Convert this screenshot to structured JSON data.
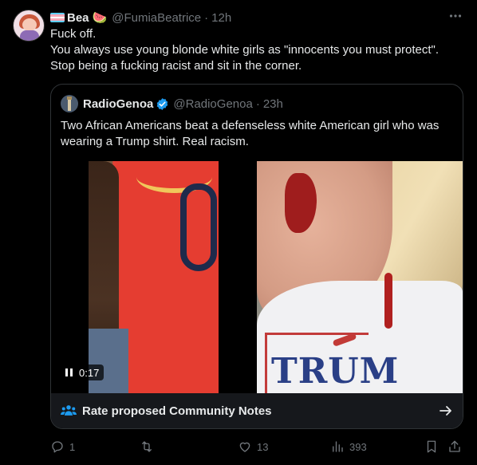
{
  "tweet": {
    "author": {
      "display_name": "Bea",
      "emoji": "🍉",
      "handle": "@FumiaBeatrice",
      "time": "12h",
      "flag": "transgender-flag"
    },
    "text_lines": [
      "Fuck off.",
      "You always use young blonde white girls as \"innocents you must protect\".",
      "Stop being a fucking racist and sit in the corner."
    ],
    "separator": "·",
    "quoted": {
      "display_name": "RadioGenoa",
      "handle": "@RadioGenoa",
      "time": "23h",
      "verified": true,
      "text": "Two African Americans beat a defenseless white American girl who was wearing a Trump shirt. Real racism.",
      "video_duration": "0:17",
      "community_notes_label": "Rate proposed Community Notes",
      "shirt_text": "TRUM"
    },
    "actions": {
      "replies": "1",
      "retweets": "",
      "likes": "13",
      "views": "393"
    }
  },
  "colors": {
    "accent": "#1d9bf0",
    "muted": "#71767b",
    "text": "#e7e9ea",
    "background": "#000000"
  }
}
